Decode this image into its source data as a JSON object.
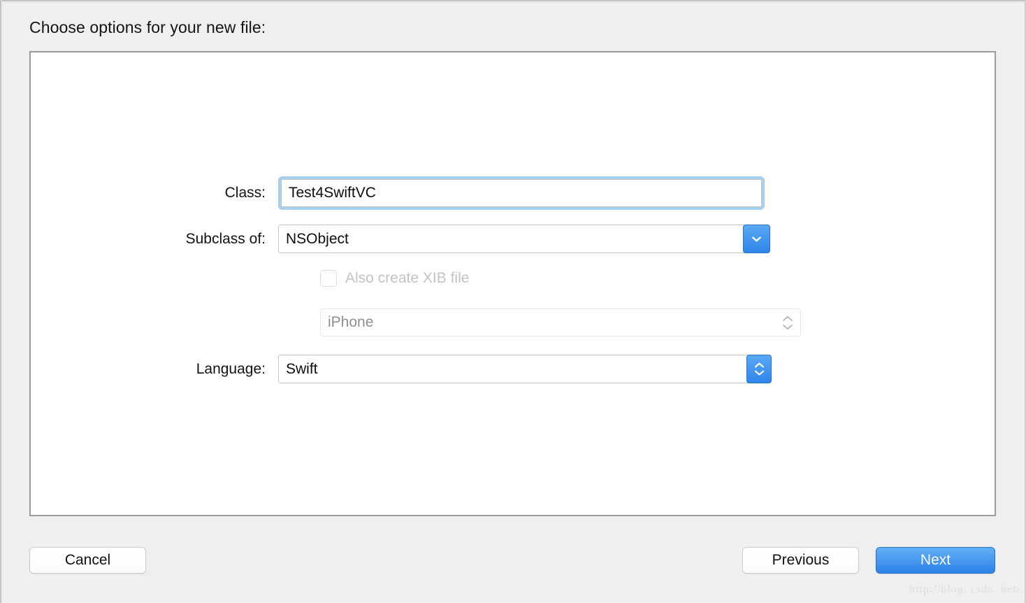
{
  "dialog": {
    "title": "Choose options for your new file:"
  },
  "form": {
    "class_row": {
      "label": "Class:",
      "value": "Test4SwiftVC",
      "focused": true
    },
    "subclass_row": {
      "label": "Subclass of:",
      "value": "NSObject",
      "dropdown_icon": "chevron-down-icon"
    },
    "xib_row": {
      "label": "Also create XIB file",
      "checked": false,
      "enabled": false
    },
    "device_row": {
      "value": "iPhone",
      "enabled": false,
      "stepper_icon": "chevron-up-down-icon"
    },
    "language_row": {
      "label": "Language:",
      "value": "Swift",
      "stepper_icon": "chevron-up-down-icon"
    }
  },
  "footer": {
    "cancel_label": "Cancel",
    "previous_label": "Previous",
    "next_label": "Next"
  },
  "watermark": {
    "text": "http://blog. csdn. net/"
  },
  "colors": {
    "accent_blue": "#2f86ea",
    "focus_ring": "#a9cfee",
    "page_background": "#efefef",
    "panel_border": "#9b9b9b",
    "disabled_text": "#8e8e93",
    "disabled_label": "#c3c3c3"
  }
}
